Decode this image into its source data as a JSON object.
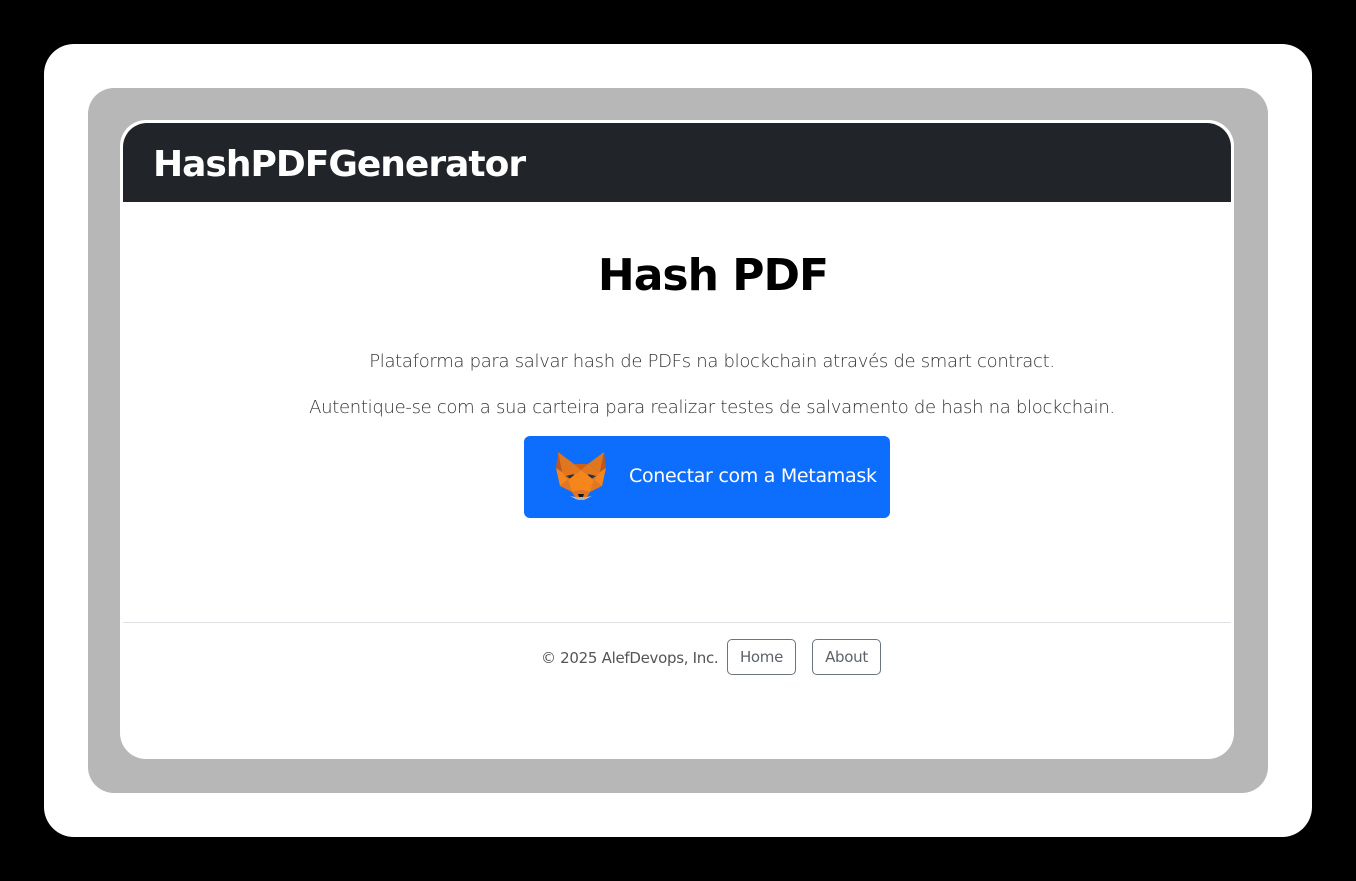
{
  "navbar": {
    "brand": "HashPDFGenerator"
  },
  "main": {
    "title": "Hash PDF",
    "lead_1": "Plataforma para salvar hash de PDFs na blockchain através de smart contract.",
    "lead_2": "Autentique-se com a sua carteira para realizar testes de salvamento de hash na blockchain.",
    "connect_button": {
      "label": "Conectar com a Metamask",
      "icon": "metamask-fox-icon"
    }
  },
  "footer": {
    "copyright": "© 2025 AlefDevops, Inc.",
    "links": [
      "Home",
      "About"
    ]
  },
  "colors": {
    "navbar_bg": "#212529",
    "primary": "#0d6efd",
    "frame_gray": "#b7b7b7"
  }
}
